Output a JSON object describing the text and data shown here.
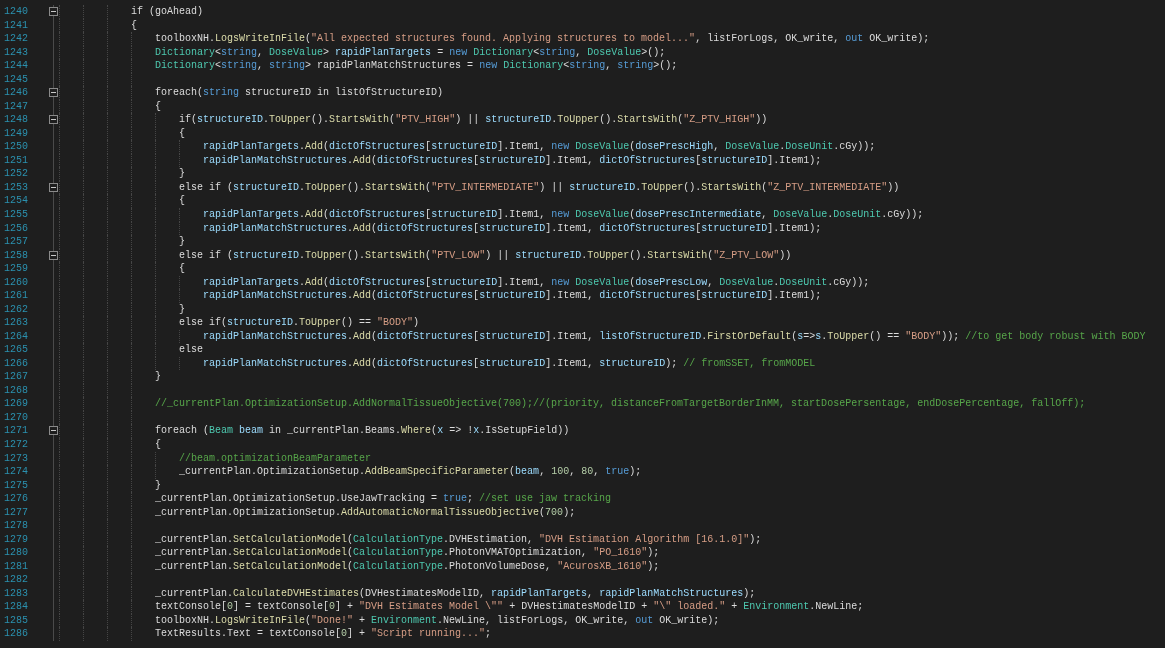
{
  "editor": {
    "lines": [
      {
        "number": "1240",
        "fold_expanded": true,
        "tokens": [
          {
            "kind": "plain",
            "text": "            if (goAhead)"
          }
        ]
      },
      {
        "number": "1241",
        "tokens": [
          {
            "kind": "plain",
            "text": "            {"
          }
        ]
      },
      {
        "number": "1242",
        "tokens": [
          {
            "kind": "plain",
            "text": "                toolboxNH."
          },
          {
            "kind": "method",
            "text": "LogsWriteInFile"
          },
          {
            "kind": "plain",
            "text": "("
          },
          {
            "kind": "string",
            "text": "\"All expected structures found. Applying structures to model...\""
          },
          {
            "kind": "plain",
            "text": ", listForLogs, OK_write, "
          },
          {
            "kind": "keyword",
            "text": "out"
          },
          {
            "kind": "plain",
            "text": " OK_write);"
          }
        ]
      },
      {
        "number": "1243",
        "tokens": [
          {
            "kind": "type",
            "text": "                Dictionary"
          },
          {
            "kind": "plain",
            "text": "<"
          },
          {
            "kind": "keyword",
            "text": "string"
          },
          {
            "kind": "plain",
            "text": ", "
          },
          {
            "kind": "type",
            "text": "DoseValue"
          },
          {
            "kind": "plain",
            "text": "> "
          },
          {
            "kind": "variable",
            "text": "rapidPlanTargets"
          },
          {
            "kind": "plain",
            "text": " = "
          },
          {
            "kind": "keyword",
            "text": "new "
          },
          {
            "kind": "type",
            "text": "Dictionary"
          },
          {
            "kind": "plain",
            "text": "<"
          },
          {
            "kind": "keyword",
            "text": "string"
          },
          {
            "kind": "plain",
            "text": ", "
          },
          {
            "kind": "type",
            "text": "DoseValue"
          },
          {
            "kind": "plain",
            "text": ">();"
          }
        ]
      },
      {
        "number": "1244",
        "tokens": [
          {
            "kind": "type",
            "text": "                Dictionary"
          },
          {
            "kind": "plain",
            "text": "<"
          },
          {
            "kind": "keyword",
            "text": "string"
          },
          {
            "kind": "plain",
            "text": ", "
          },
          {
            "kind": "keyword",
            "text": "string"
          },
          {
            "kind": "plain",
            "text": "> rapidPlanMatchStructures = "
          },
          {
            "kind": "keyword",
            "text": "new "
          },
          {
            "kind": "type",
            "text": "Dictionary"
          },
          {
            "kind": "plain",
            "text": "<"
          },
          {
            "kind": "keyword",
            "text": "string"
          },
          {
            "kind": "plain",
            "text": ", "
          },
          {
            "kind": "keyword",
            "text": "string"
          },
          {
            "kind": "plain",
            "text": ">();"
          }
        ]
      },
      {
        "number": "1245"
      },
      {
        "number": "1246",
        "fold_expanded": true,
        "tokens": [
          {
            "kind": "plain",
            "text": "                foreach("
          },
          {
            "kind": "keyword",
            "text": "string"
          },
          {
            "kind": "plain",
            "text": " structureID in listOfStructureID)"
          }
        ]
      },
      {
        "number": "1247",
        "tokens": [
          {
            "kind": "plain",
            "text": "                {"
          }
        ]
      },
      {
        "number": "1248",
        "fold_expanded": true,
        "tokens": [
          {
            "kind": "plain",
            "text": "                    if("
          },
          {
            "kind": "variable",
            "text": "structureID"
          },
          {
            "kind": "plain",
            "text": "."
          },
          {
            "kind": "method",
            "text": "ToUpper"
          },
          {
            "kind": "plain",
            "text": "()."
          },
          {
            "kind": "method",
            "text": "StartsWith"
          },
          {
            "kind": "plain",
            "text": "("
          },
          {
            "kind": "string",
            "text": "\"PTV_HIGH\""
          },
          {
            "kind": "plain",
            "text": ") || "
          },
          {
            "kind": "variable",
            "text": "structureID"
          },
          {
            "kind": "plain",
            "text": "."
          },
          {
            "kind": "method",
            "text": "ToUpper"
          },
          {
            "kind": "plain",
            "text": "()."
          },
          {
            "kind": "method",
            "text": "StartsWith"
          },
          {
            "kind": "plain",
            "text": "("
          },
          {
            "kind": "string",
            "text": "\"Z_PTV_HIGH\""
          },
          {
            "kind": "plain",
            "text": "))"
          }
        ]
      },
      {
        "number": "1249",
        "tokens": [
          {
            "kind": "plain",
            "text": "                    {"
          }
        ]
      },
      {
        "number": "1250",
        "tokens": [
          {
            "kind": "variable",
            "text": "                        rapidPlanTargets"
          },
          {
            "kind": "plain",
            "text": "."
          },
          {
            "kind": "method",
            "text": "Add"
          },
          {
            "kind": "plain",
            "text": "("
          },
          {
            "kind": "variable",
            "text": "dictOfStructures"
          },
          {
            "kind": "plain",
            "text": "["
          },
          {
            "kind": "variable",
            "text": "structureID"
          },
          {
            "kind": "plain",
            "text": "].Item1, "
          },
          {
            "kind": "keyword",
            "text": "new "
          },
          {
            "kind": "type",
            "text": "DoseValue"
          },
          {
            "kind": "plain",
            "text": "("
          },
          {
            "kind": "variable",
            "text": "dosePrescHigh"
          },
          {
            "kind": "plain",
            "text": ", "
          },
          {
            "kind": "type",
            "text": "DoseValue"
          },
          {
            "kind": "plain",
            "text": "."
          },
          {
            "kind": "type",
            "text": "DoseUnit"
          },
          {
            "kind": "plain",
            "text": ".cGy));"
          }
        ]
      },
      {
        "number": "1251",
        "tokens": [
          {
            "kind": "variable",
            "text": "                        rapidPlanMatchStructures"
          },
          {
            "kind": "plain",
            "text": "."
          },
          {
            "kind": "method",
            "text": "Add"
          },
          {
            "kind": "plain",
            "text": "("
          },
          {
            "kind": "variable",
            "text": "dictOfStructures"
          },
          {
            "kind": "plain",
            "text": "["
          },
          {
            "kind": "variable",
            "text": "structureID"
          },
          {
            "kind": "plain",
            "text": "].Item1, "
          },
          {
            "kind": "variable",
            "text": "dictOfStructures"
          },
          {
            "kind": "plain",
            "text": "["
          },
          {
            "kind": "variable",
            "text": "structureID"
          },
          {
            "kind": "plain",
            "text": "].Item1);"
          }
        ]
      },
      {
        "number": "1252",
        "tokens": [
          {
            "kind": "plain",
            "text": "                    }"
          }
        ]
      },
      {
        "number": "1253",
        "fold_expanded": true,
        "tokens": [
          {
            "kind": "plain",
            "text": "                    else if ("
          },
          {
            "kind": "variable",
            "text": "structureID"
          },
          {
            "kind": "plain",
            "text": "."
          },
          {
            "kind": "method",
            "text": "ToUpper"
          },
          {
            "kind": "plain",
            "text": "()."
          },
          {
            "kind": "method",
            "text": "StartsWith"
          },
          {
            "kind": "plain",
            "text": "("
          },
          {
            "kind": "string",
            "text": "\"PTV_INTERMEDIATE\""
          },
          {
            "kind": "plain",
            "text": ") || "
          },
          {
            "kind": "variable",
            "text": "structureID"
          },
          {
            "kind": "plain",
            "text": "."
          },
          {
            "kind": "method",
            "text": "ToUpper"
          },
          {
            "kind": "plain",
            "text": "()."
          },
          {
            "kind": "method",
            "text": "StartsWith"
          },
          {
            "kind": "plain",
            "text": "("
          },
          {
            "kind": "string",
            "text": "\"Z_PTV_INTERMEDIATE\""
          },
          {
            "kind": "plain",
            "text": "))"
          }
        ]
      },
      {
        "number": "1254",
        "tokens": [
          {
            "kind": "plain",
            "text": "                    {"
          }
        ]
      },
      {
        "number": "1255",
        "tokens": [
          {
            "kind": "variable",
            "text": "                        rapidPlanTargets"
          },
          {
            "kind": "plain",
            "text": "."
          },
          {
            "kind": "method",
            "text": "Add"
          },
          {
            "kind": "plain",
            "text": "("
          },
          {
            "kind": "variable",
            "text": "dictOfStructures"
          },
          {
            "kind": "plain",
            "text": "["
          },
          {
            "kind": "variable",
            "text": "structureID"
          },
          {
            "kind": "plain",
            "text": "].Item1, "
          },
          {
            "kind": "keyword",
            "text": "new "
          },
          {
            "kind": "type",
            "text": "DoseValue"
          },
          {
            "kind": "plain",
            "text": "("
          },
          {
            "kind": "variable",
            "text": "dosePrescIntermediate"
          },
          {
            "kind": "plain",
            "text": ", "
          },
          {
            "kind": "type",
            "text": "DoseValue"
          },
          {
            "kind": "plain",
            "text": "."
          },
          {
            "kind": "type",
            "text": "DoseUnit"
          },
          {
            "kind": "plain",
            "text": ".cGy));"
          }
        ]
      },
      {
        "number": "1256",
        "tokens": [
          {
            "kind": "variable",
            "text": "                        rapidPlanMatchStructures"
          },
          {
            "kind": "plain",
            "text": "."
          },
          {
            "kind": "method",
            "text": "Add"
          },
          {
            "kind": "plain",
            "text": "("
          },
          {
            "kind": "variable",
            "text": "dictOfStructures"
          },
          {
            "kind": "plain",
            "text": "["
          },
          {
            "kind": "variable",
            "text": "structureID"
          },
          {
            "kind": "plain",
            "text": "].Item1, "
          },
          {
            "kind": "variable",
            "text": "dictOfStructures"
          },
          {
            "kind": "plain",
            "text": "["
          },
          {
            "kind": "variable",
            "text": "structureID"
          },
          {
            "kind": "plain",
            "text": "].Item1);"
          }
        ]
      },
      {
        "number": "1257",
        "tokens": [
          {
            "kind": "plain",
            "text": "                    }"
          }
        ]
      },
      {
        "number": "1258",
        "fold_expanded": true,
        "tokens": [
          {
            "kind": "plain",
            "text": "                    else if ("
          },
          {
            "kind": "variable",
            "text": "structureID"
          },
          {
            "kind": "plain",
            "text": "."
          },
          {
            "kind": "method",
            "text": "ToUpper"
          },
          {
            "kind": "plain",
            "text": "()."
          },
          {
            "kind": "method",
            "text": "StartsWith"
          },
          {
            "kind": "plain",
            "text": "("
          },
          {
            "kind": "string",
            "text": "\"PTV_LOW\""
          },
          {
            "kind": "plain",
            "text": ") || "
          },
          {
            "kind": "variable",
            "text": "structureID"
          },
          {
            "kind": "plain",
            "text": "."
          },
          {
            "kind": "method",
            "text": "ToUpper"
          },
          {
            "kind": "plain",
            "text": "()."
          },
          {
            "kind": "method",
            "text": "StartsWith"
          },
          {
            "kind": "plain",
            "text": "("
          },
          {
            "kind": "string",
            "text": "\"Z_PTV_LOW\""
          },
          {
            "kind": "plain",
            "text": "))"
          }
        ]
      },
      {
        "number": "1259",
        "tokens": [
          {
            "kind": "plain",
            "text": "                    {"
          }
        ]
      },
      {
        "number": "1260",
        "tokens": [
          {
            "kind": "variable",
            "text": "                        rapidPlanTargets"
          },
          {
            "kind": "plain",
            "text": "."
          },
          {
            "kind": "method",
            "text": "Add"
          },
          {
            "kind": "plain",
            "text": "("
          },
          {
            "kind": "variable",
            "text": "dictOfStructures"
          },
          {
            "kind": "plain",
            "text": "["
          },
          {
            "kind": "variable",
            "text": "structureID"
          },
          {
            "kind": "plain",
            "text": "].Item1, "
          },
          {
            "kind": "keyword",
            "text": "new "
          },
          {
            "kind": "type",
            "text": "DoseValue"
          },
          {
            "kind": "plain",
            "text": "("
          },
          {
            "kind": "variable",
            "text": "dosePrescLow"
          },
          {
            "kind": "plain",
            "text": ", "
          },
          {
            "kind": "type",
            "text": "DoseValue"
          },
          {
            "kind": "plain",
            "text": "."
          },
          {
            "kind": "type",
            "text": "DoseUnit"
          },
          {
            "kind": "plain",
            "text": ".cGy));"
          }
        ]
      },
      {
        "number": "1261",
        "tokens": [
          {
            "kind": "variable",
            "text": "                        rapidPlanMatchStructures"
          },
          {
            "kind": "plain",
            "text": "."
          },
          {
            "kind": "method",
            "text": "Add"
          },
          {
            "kind": "plain",
            "text": "("
          },
          {
            "kind": "variable",
            "text": "dictOfStructures"
          },
          {
            "kind": "plain",
            "text": "["
          },
          {
            "kind": "variable",
            "text": "structureID"
          },
          {
            "kind": "plain",
            "text": "].Item1, "
          },
          {
            "kind": "variable",
            "text": "dictOfStructures"
          },
          {
            "kind": "plain",
            "text": "["
          },
          {
            "kind": "variable",
            "text": "structureID"
          },
          {
            "kind": "plain",
            "text": "].Item1);"
          }
        ]
      },
      {
        "number": "1262",
        "tokens": [
          {
            "kind": "plain",
            "text": "                    }"
          }
        ]
      },
      {
        "number": "1263",
        "tokens": [
          {
            "kind": "plain",
            "text": "                    else if("
          },
          {
            "kind": "variable",
            "text": "structureID"
          },
          {
            "kind": "plain",
            "text": "."
          },
          {
            "kind": "method",
            "text": "ToUpper"
          },
          {
            "kind": "plain",
            "text": "() == "
          },
          {
            "kind": "string",
            "text": "\"BODY\""
          },
          {
            "kind": "plain",
            "text": ")"
          }
        ]
      },
      {
        "number": "1264",
        "tokens": [
          {
            "kind": "variable",
            "text": "                        rapidPlanMatchStructures"
          },
          {
            "kind": "plain",
            "text": "."
          },
          {
            "kind": "method",
            "text": "Add"
          },
          {
            "kind": "plain",
            "text": "("
          },
          {
            "kind": "variable",
            "text": "dictOfStructures"
          },
          {
            "kind": "plain",
            "text": "["
          },
          {
            "kind": "variable",
            "text": "structureID"
          },
          {
            "kind": "plain",
            "text": "].Item1, "
          },
          {
            "kind": "variable",
            "text": "listOfStructureID"
          },
          {
            "kind": "plain",
            "text": "."
          },
          {
            "kind": "method",
            "text": "FirstOrDefault"
          },
          {
            "kind": "plain",
            "text": "("
          },
          {
            "kind": "variable",
            "text": "s"
          },
          {
            "kind": "plain",
            "text": "=>"
          },
          {
            "kind": "variable",
            "text": "s"
          },
          {
            "kind": "plain",
            "text": "."
          },
          {
            "kind": "method",
            "text": "ToUpper"
          },
          {
            "kind": "plain",
            "text": "() == "
          },
          {
            "kind": "string",
            "text": "\"BODY\""
          },
          {
            "kind": "plain",
            "text": ")); "
          },
          {
            "kind": "comment",
            "text": "//to get body robust with BODY"
          }
        ]
      },
      {
        "number": "1265",
        "tokens": [
          {
            "kind": "plain",
            "text": "                    else"
          }
        ]
      },
      {
        "number": "1266",
        "tokens": [
          {
            "kind": "variable",
            "text": "                        rapidPlanMatchStructures"
          },
          {
            "kind": "plain",
            "text": "."
          },
          {
            "kind": "method",
            "text": "Add"
          },
          {
            "kind": "plain",
            "text": "("
          },
          {
            "kind": "variable",
            "text": "dictOfStructures"
          },
          {
            "kind": "plain",
            "text": "["
          },
          {
            "kind": "variable",
            "text": "structureID"
          },
          {
            "kind": "plain",
            "text": "].Item1, "
          },
          {
            "kind": "variable",
            "text": "structureID"
          },
          {
            "kind": "plain",
            "text": "); "
          },
          {
            "kind": "comment",
            "text": "// fromSSET, fromMODEL"
          }
        ]
      },
      {
        "number": "1267",
        "tokens": [
          {
            "kind": "plain",
            "text": "                }"
          }
        ]
      },
      {
        "number": "1268"
      },
      {
        "number": "1269",
        "tokens": [
          {
            "kind": "comment",
            "text": "                //_currentPlan.OptimizationSetup.AddNormalTissueObjective(700);//(priority, distanceFromTargetBorderInMM, startDosePersentage, endDosePercentage, fallOff);"
          }
        ]
      },
      {
        "number": "1270"
      },
      {
        "number": "1271",
        "fold_expanded": true,
        "tokens": [
          {
            "kind": "plain",
            "text": "                foreach ("
          },
          {
            "kind": "type",
            "text": "Beam "
          },
          {
            "kind": "variable",
            "text": "beam"
          },
          {
            "kind": "plain",
            "text": " in _currentPlan.Beams."
          },
          {
            "kind": "method",
            "text": "Where"
          },
          {
            "kind": "plain",
            "text": "("
          },
          {
            "kind": "variable",
            "text": "x"
          },
          {
            "kind": "plain",
            "text": " => !"
          },
          {
            "kind": "variable",
            "text": "x"
          },
          {
            "kind": "plain",
            "text": ".IsSetupField))"
          }
        ]
      },
      {
        "number": "1272",
        "tokens": [
          {
            "kind": "plain",
            "text": "                {"
          }
        ]
      },
      {
        "number": "1273",
        "tokens": [
          {
            "kind": "comment",
            "text": "                    //beam.optimizationBeamParameter"
          }
        ]
      },
      {
        "number": "1274",
        "tokens": [
          {
            "kind": "plain",
            "text": "                    _currentPlan.OptimizationSetup."
          },
          {
            "kind": "method",
            "text": "AddBeamSpecificParameter"
          },
          {
            "kind": "plain",
            "text": "("
          },
          {
            "kind": "variable",
            "text": "beam"
          },
          {
            "kind": "plain",
            "text": ", "
          },
          {
            "kind": "number",
            "text": "100"
          },
          {
            "kind": "plain",
            "text": ", "
          },
          {
            "kind": "number",
            "text": "80"
          },
          {
            "kind": "plain",
            "text": ", "
          },
          {
            "kind": "keyword",
            "text": "true"
          },
          {
            "kind": "plain",
            "text": ");"
          }
        ]
      },
      {
        "number": "1275",
        "tokens": [
          {
            "kind": "plain",
            "text": "                }"
          }
        ]
      },
      {
        "number": "1276",
        "tokens": [
          {
            "kind": "plain",
            "text": "                _currentPlan.OptimizationSetup.UseJawTracking = "
          },
          {
            "kind": "keyword",
            "text": "true"
          },
          {
            "kind": "plain",
            "text": "; "
          },
          {
            "kind": "comment",
            "text": "//set use jaw tracking"
          }
        ]
      },
      {
        "number": "1277",
        "tokens": [
          {
            "kind": "plain",
            "text": "                _currentPlan.OptimizationSetup."
          },
          {
            "kind": "method",
            "text": "AddAutomaticNormalTissueObjective"
          },
          {
            "kind": "plain",
            "text": "("
          },
          {
            "kind": "number",
            "text": "700"
          },
          {
            "kind": "plain",
            "text": ");"
          }
        ]
      },
      {
        "number": "1278"
      },
      {
        "number": "1279",
        "tokens": [
          {
            "kind": "plain",
            "text": "                _currentPlan."
          },
          {
            "kind": "method",
            "text": "SetCalculationModel"
          },
          {
            "kind": "plain",
            "text": "("
          },
          {
            "kind": "type",
            "text": "CalculationType"
          },
          {
            "kind": "plain",
            "text": ".DVHEstimation, "
          },
          {
            "kind": "string",
            "text": "\"DVH Estimation Algorithm [16.1.0]\""
          },
          {
            "kind": "plain",
            "text": ");"
          }
        ]
      },
      {
        "number": "1280",
        "tokens": [
          {
            "kind": "plain",
            "text": "                _currentPlan."
          },
          {
            "kind": "method",
            "text": "SetCalculationModel"
          },
          {
            "kind": "plain",
            "text": "("
          },
          {
            "kind": "type",
            "text": "CalculationType"
          },
          {
            "kind": "plain",
            "text": ".PhotonVMATOptimization, "
          },
          {
            "kind": "string",
            "text": "\"PO_1610\""
          },
          {
            "kind": "plain",
            "text": ");"
          }
        ]
      },
      {
        "number": "1281",
        "tokens": [
          {
            "kind": "plain",
            "text": "                _currentPlan."
          },
          {
            "kind": "method",
            "text": "SetCalculationModel"
          },
          {
            "kind": "plain",
            "text": "("
          },
          {
            "kind": "type",
            "text": "CalculationType"
          },
          {
            "kind": "plain",
            "text": ".PhotonVolumeDose, "
          },
          {
            "kind": "string",
            "text": "\"AcurosXB_1610\""
          },
          {
            "kind": "plain",
            "text": ");"
          }
        ]
      },
      {
        "number": "1282"
      },
      {
        "number": "1283",
        "tokens": [
          {
            "kind": "plain",
            "text": "                _currentPlan."
          },
          {
            "kind": "method",
            "text": "CalculateDVHEstimates"
          },
          {
            "kind": "plain",
            "text": "(DVHestimatesModelID, "
          },
          {
            "kind": "variable",
            "text": "rapidPlanTargets"
          },
          {
            "kind": "plain",
            "text": ", "
          },
          {
            "kind": "variable",
            "text": "rapidPlanMatchStructures"
          },
          {
            "kind": "plain",
            "text": ");"
          }
        ]
      },
      {
        "number": "1284",
        "tokens": [
          {
            "kind": "plain",
            "text": "                textConsole["
          },
          {
            "kind": "number",
            "text": "0"
          },
          {
            "kind": "plain",
            "text": "] = textConsole["
          },
          {
            "kind": "number",
            "text": "0"
          },
          {
            "kind": "plain",
            "text": "] + "
          },
          {
            "kind": "string",
            "text": "\"DVH Estimates Model \\\"\""
          },
          {
            "kind": "plain",
            "text": " + DVHestimatesModelID + "
          },
          {
            "kind": "string",
            "text": "\"\\\" loaded.\""
          },
          {
            "kind": "plain",
            "text": " + "
          },
          {
            "kind": "type",
            "text": "Environment"
          },
          {
            "kind": "plain",
            "text": ".NewLine;"
          }
        ]
      },
      {
        "number": "1285",
        "tokens": [
          {
            "kind": "plain",
            "text": "                toolboxNH."
          },
          {
            "kind": "method",
            "text": "LogsWriteInFile"
          },
          {
            "kind": "plain",
            "text": "("
          },
          {
            "kind": "string",
            "text": "\"Done!\""
          },
          {
            "kind": "plain",
            "text": " + "
          },
          {
            "kind": "type",
            "text": "Environment"
          },
          {
            "kind": "plain",
            "text": ".NewLine, listForLogs, OK_write, "
          },
          {
            "kind": "keyword",
            "text": "out"
          },
          {
            "kind": "plain",
            "text": " OK_write);"
          }
        ]
      },
      {
        "number": "1286",
        "tokens": [
          {
            "kind": "plain",
            "text": "                TextResults.Text = textConsole["
          },
          {
            "kind": "number",
            "text": "0"
          },
          {
            "kind": "plain",
            "text": "] + "
          },
          {
            "kind": "string",
            "text": "\"Script running...\""
          },
          {
            "kind": "plain",
            "text": ";"
          }
        ]
      }
    ]
  }
}
